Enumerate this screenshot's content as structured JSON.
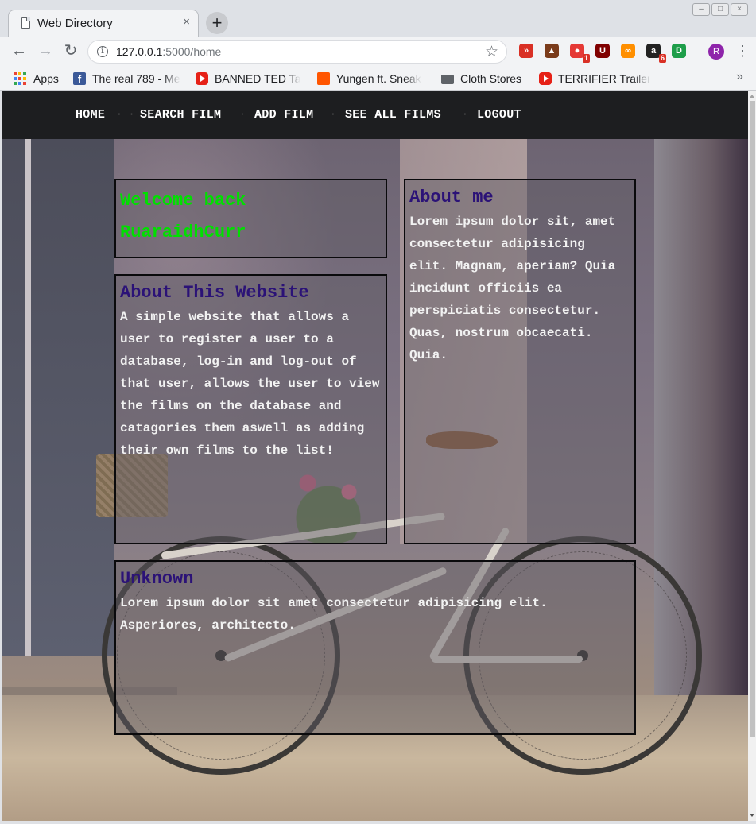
{
  "browser": {
    "tab_title": "Web Directory",
    "tab_close": "×",
    "new_tab": "+",
    "url_host": "127.0.0.1",
    "url_rest": ":5000/home",
    "back": "←",
    "forward": "→",
    "reload": "↻",
    "star": "☆",
    "profile_initial": "R",
    "menu": "⋮",
    "window_controls": [
      "–",
      "□",
      "×"
    ],
    "extensions": [
      {
        "name": "extension-red-arrows-icon",
        "color": "#d93025",
        "glyph": "»",
        "badge": ""
      },
      {
        "name": "extension-hat-icon",
        "color": "#7a3b1a",
        "glyph": "▲",
        "badge": ""
      },
      {
        "name": "extension-chrome-red-icon",
        "color": "#e53935",
        "glyph": "●",
        "badge": "1"
      },
      {
        "name": "extension-ublock-icon",
        "color": "#800000",
        "glyph": "U",
        "badge": ""
      },
      {
        "name": "extension-infinity-icon",
        "color": "#ff8f00",
        "glyph": "∞",
        "badge": ""
      },
      {
        "name": "extension-amazon-icon",
        "color": "#222222",
        "glyph": "a",
        "badge": "6"
      },
      {
        "name": "extension-green-id-icon",
        "color": "#1e9e4a",
        "glyph": "D",
        "badge": ""
      }
    ],
    "bookmarks": [
      {
        "label": "Apps"
      },
      {
        "label": "The real 789 - Me"
      },
      {
        "label": "BANNED TED Ta"
      },
      {
        "label": "Yungen ft. Sneak"
      },
      {
        "label": "Cloth Stores"
      },
      {
        "label": "TERRIFIER Trailer"
      }
    ],
    "bookmarks_more": "»"
  },
  "nav": {
    "items": [
      "HOME",
      "SEARCH FILM",
      "ADD FILM",
      "SEE ALL FILMS",
      "LOGOUT"
    ],
    "separators": [
      "· ·",
      "·",
      "·",
      "·"
    ]
  },
  "welcome": {
    "line1": "Welcome back",
    "line2": "RuaraidhCurr"
  },
  "about_website": {
    "title": "About This Website",
    "body": "A simple website that allows a user to register a user to a database, log-in and log-out of that user, allows the user to view the films on the database and catagories them aswell as adding their own films to the list!"
  },
  "about_me": {
    "title": "About me",
    "body": "Lorem ipsum dolor sit, amet consectetur adipisicing elit. Magnam, aperiam? Quia incidunt officiis ea perspiciatis consectetur. Quas, nostrum obcaecati. Quia."
  },
  "unknown": {
    "title": "Unknown",
    "body": "Lorem ipsum dolor sit amet consectetur adipisicing elit. Asperiores, architecto."
  }
}
